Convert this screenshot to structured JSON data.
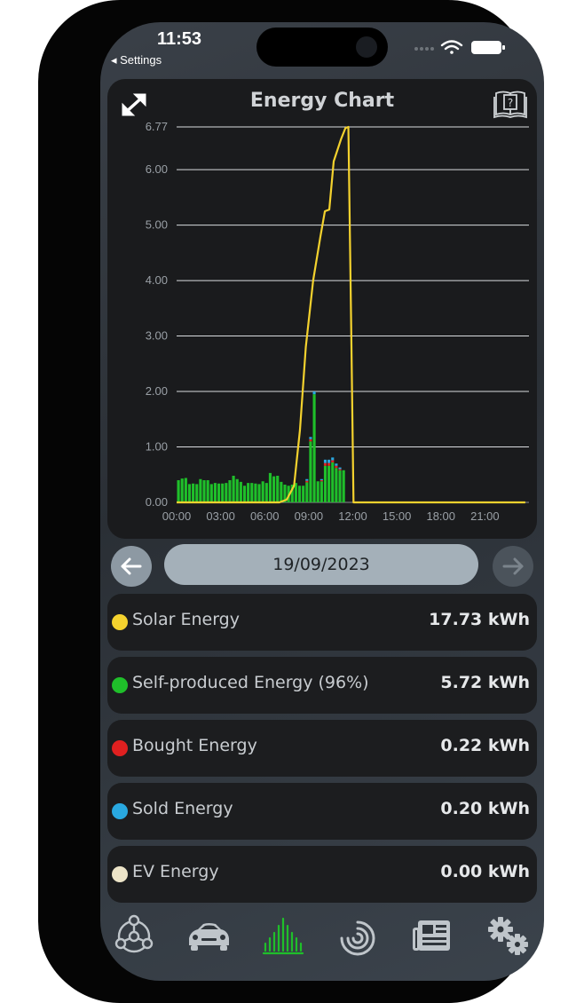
{
  "status_bar": {
    "time": "11:53",
    "back_label": "◂ Settings"
  },
  "energy_chart": {
    "title": "Energy Chart",
    "expand_icon": "expand-icon",
    "help_icon": "book-help-icon"
  },
  "chart_data": {
    "type": "bar",
    "title": "Energy Chart",
    "xlabel": "",
    "ylabel": "",
    "ylim": [
      0,
      6.77
    ],
    "y_ticks": [
      "0.00",
      "1.00",
      "2.00",
      "3.00",
      "4.00",
      "5.00",
      "6.00",
      "6.77"
    ],
    "x_ticks": [
      "00:00",
      "03:00",
      "06:00",
      "09:00",
      "12:00",
      "15:00",
      "18:00",
      "21:00"
    ],
    "grid": true,
    "bar_interval_hours": 0.25,
    "bar_series": [
      {
        "name": "Self-produced Energy",
        "color": "#1fbf2a",
        "values": [
          0.4,
          0.43,
          0.44,
          0.33,
          0.34,
          0.33,
          0.42,
          0.4,
          0.4,
          0.33,
          0.35,
          0.34,
          0.34,
          0.35,
          0.4,
          0.48,
          0.42,
          0.37,
          0.3,
          0.35,
          0.35,
          0.34,
          0.33,
          0.38,
          0.35,
          0.53,
          0.47,
          0.48,
          0.37,
          0.32,
          0.3,
          0.32,
          0.35,
          0.3,
          0.3,
          0.36,
          1.1,
          1.95,
          0.38,
          0.38,
          0.66,
          0.66,
          0.72,
          0.62,
          0.58,
          0.58,
          0.0,
          0.0
        ]
      },
      {
        "name": "Bought Energy",
        "color": "#e02020",
        "values": [
          0,
          0,
          0,
          0,
          0,
          0,
          0,
          0,
          0,
          0,
          0,
          0,
          0,
          0,
          0,
          0,
          0,
          0,
          0,
          0,
          0,
          0,
          0,
          0,
          0,
          0,
          0,
          0,
          0,
          0,
          0,
          0,
          0,
          0,
          0,
          0.03,
          0.04,
          0,
          0,
          0.02,
          0.05,
          0.05,
          0.04,
          0.04,
          0.02,
          0,
          0,
          0
        ]
      },
      {
        "name": "Sold Energy",
        "color": "#29a8e0",
        "values": [
          0,
          0,
          0,
          0,
          0,
          0,
          0,
          0,
          0,
          0,
          0,
          0,
          0,
          0,
          0,
          0,
          0,
          0,
          0,
          0,
          0,
          0,
          0,
          0,
          0,
          0,
          0,
          0,
          0,
          0,
          0,
          0,
          0,
          0,
          0,
          0.03,
          0.04,
          0.05,
          0,
          0.02,
          0.06,
          0.06,
          0.05,
          0.04,
          0.03,
          0,
          0,
          0
        ]
      }
    ],
    "line_series": {
      "name": "Solar Energy",
      "color": "#f4d22e",
      "points": [
        [
          0,
          0
        ],
        [
          7.0,
          0
        ],
        [
          7.5,
          0.05
        ],
        [
          8.0,
          0.3
        ],
        [
          8.4,
          1.3
        ],
        [
          8.8,
          2.8
        ],
        [
          9.3,
          4.0
        ],
        [
          9.8,
          4.8
        ],
        [
          10.1,
          5.25
        ],
        [
          10.4,
          5.28
        ],
        [
          10.7,
          6.15
        ],
        [
          11.2,
          6.55
        ],
        [
          11.5,
          6.75
        ],
        [
          11.7,
          6.77
        ],
        [
          11.9,
          3.0
        ],
        [
          12.05,
          0
        ],
        [
          23.75,
          0
        ]
      ]
    }
  },
  "date_nav": {
    "date": "19/09/2023",
    "prev_icon": "arrow-left-icon",
    "next_icon": "arrow-right-icon"
  },
  "summary": [
    {
      "label": "Solar Energy",
      "value": "17.73 kWh",
      "color": "#f4d22e"
    },
    {
      "label": "Self-produced Energy (96%)",
      "value": "5.72 kWh",
      "color": "#1fbf2a"
    },
    {
      "label": "Bought Energy",
      "value": "0.22 kWh",
      "color": "#e02020"
    },
    {
      "label": "Sold Energy",
      "value": "0.20 kWh",
      "color": "#29a8e0"
    },
    {
      "label": "EV Energy",
      "value": "0.00 kWh",
      "color": "#ece4c8"
    }
  ],
  "tab_bar": [
    {
      "icon": "network-hub-icon",
      "active": false
    },
    {
      "icon": "car-icon",
      "active": false
    },
    {
      "icon": "bar-chart-icon",
      "active": true
    },
    {
      "icon": "radial-gauge-icon",
      "active": false
    },
    {
      "icon": "news-icon",
      "active": false
    },
    {
      "icon": "gears-icon",
      "active": false
    }
  ],
  "colors": {
    "accent": "#1fbf2a",
    "card_bg": "#1a1b1d"
  }
}
